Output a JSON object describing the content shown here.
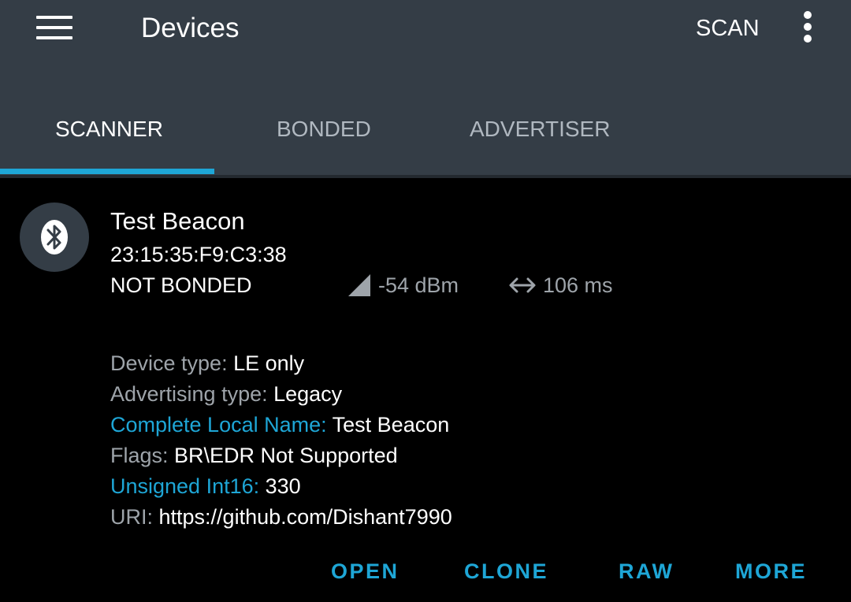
{
  "toolbar": {
    "title": "Devices",
    "scan_label": "SCAN",
    "menu_icon": "hamburger-menu-icon",
    "overflow_icon": "more-vertical-icon"
  },
  "tabs": [
    {
      "label": "SCANNER",
      "active": true
    },
    {
      "label": "BONDED",
      "active": false
    },
    {
      "label": "ADVERTISER",
      "active": false
    }
  ],
  "colors": {
    "appbar": "#343d46",
    "accent": "#1ea6d6",
    "background": "#000000",
    "secondary_text": "#9ea4aa"
  },
  "device": {
    "icon": "bluetooth-icon",
    "name": "Test Beacon",
    "address": "23:15:35:F9:C3:38",
    "bond_state": "NOT BONDED",
    "rssi": "-54 dBm",
    "interval": "106 ms",
    "details": [
      {
        "label": "Device type: ",
        "value": "LE only"
      },
      {
        "label": "Advertising type: ",
        "value": "Legacy"
      },
      {
        "label": "Complete Local Name: ",
        "value": "Test Beacon"
      },
      {
        "label": "Flags: ",
        "value": "BR\\EDR Not Supported"
      },
      {
        "label": "Unsigned Int16: ",
        "value": "330"
      },
      {
        "label": "URI: ",
        "value": "https://github.com/Dishant7990"
      }
    ]
  },
  "actions": {
    "open": "OPEN",
    "clone": "CLONE",
    "raw": "RAW",
    "more": "MORE"
  }
}
